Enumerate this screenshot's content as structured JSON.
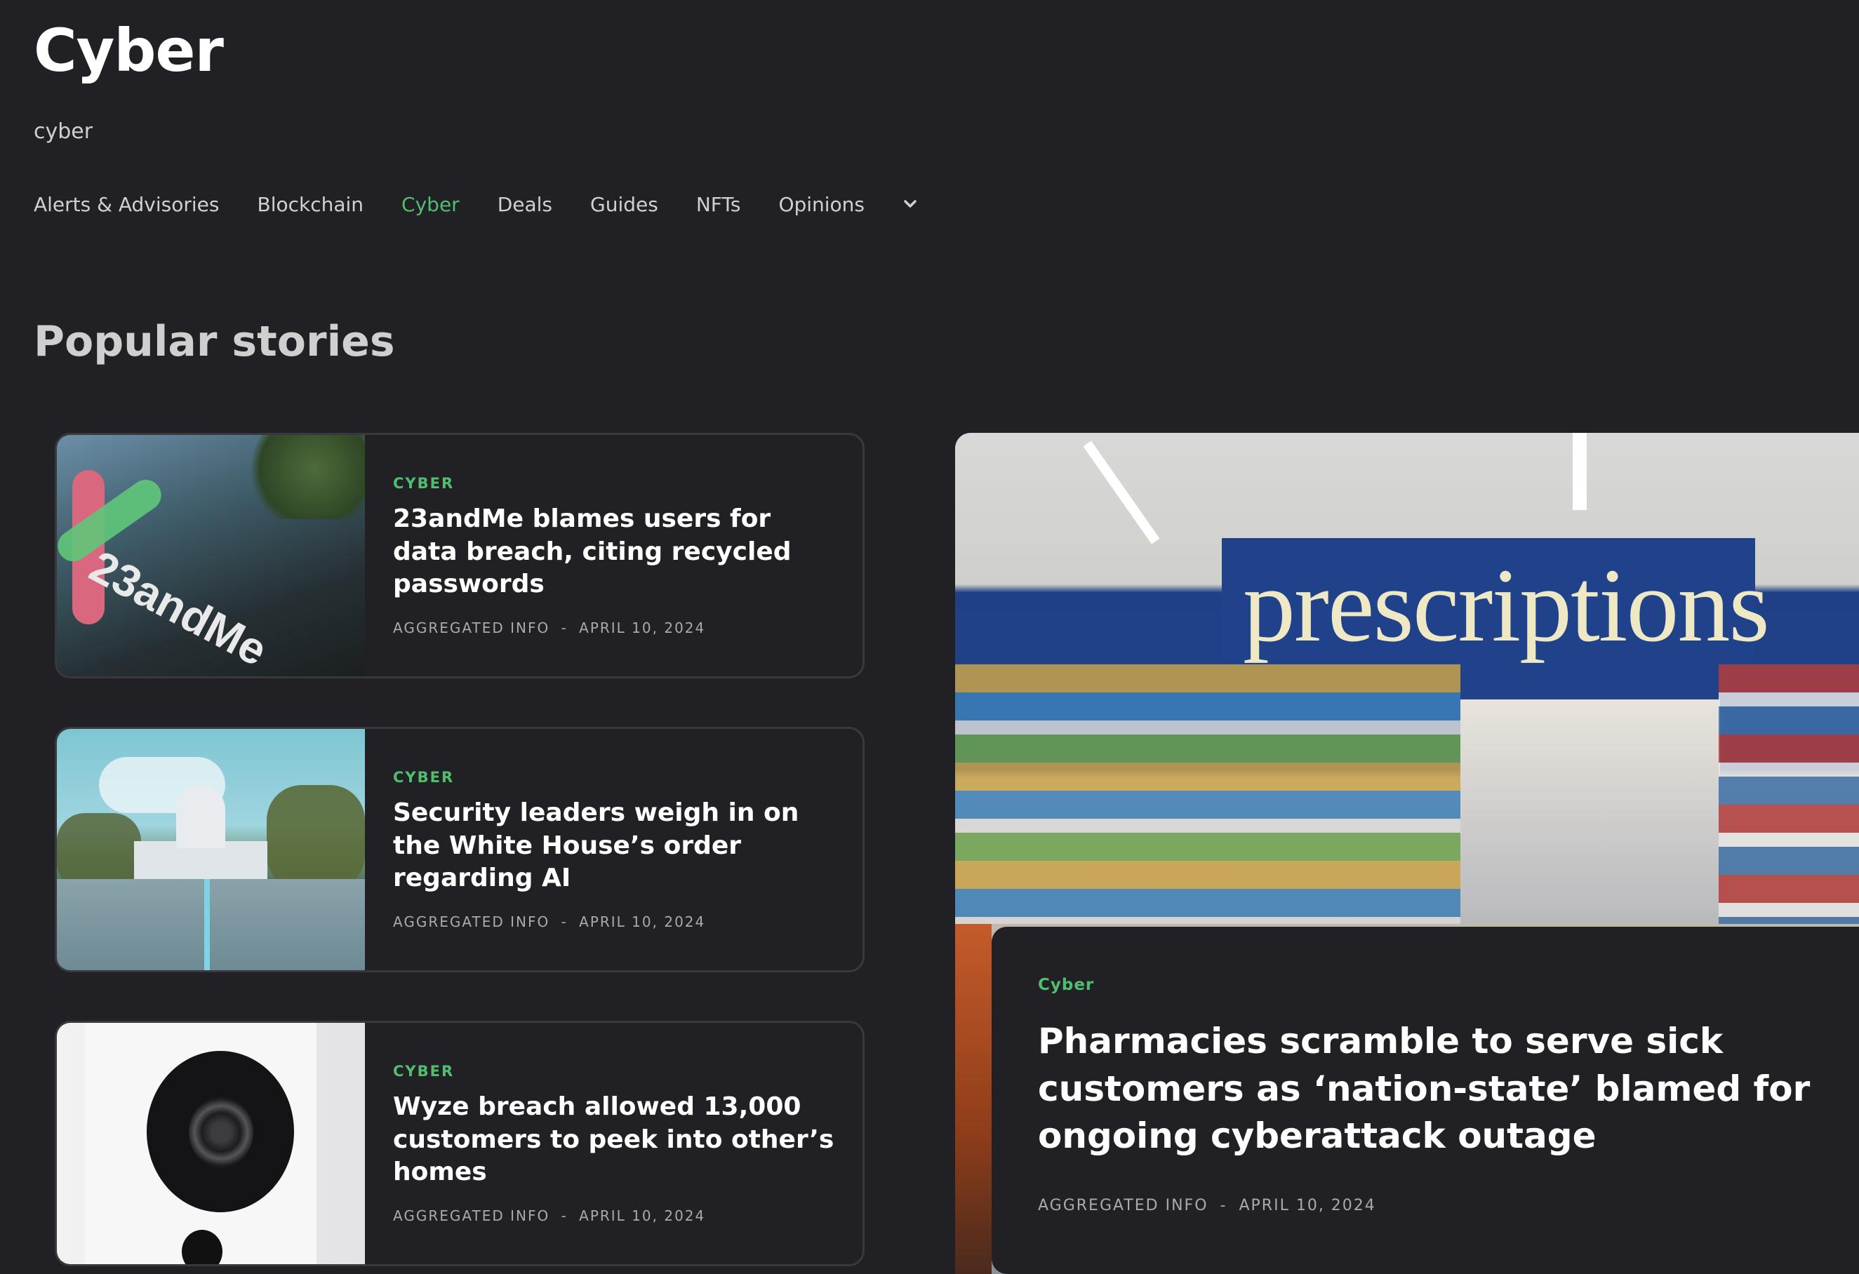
{
  "header": {
    "title": "Cyber",
    "subtitle": "cyber"
  },
  "nav": {
    "items": [
      {
        "label": "Alerts & Advisories",
        "active": false
      },
      {
        "label": "Blockchain",
        "active": false
      },
      {
        "label": "Cyber",
        "active": true
      },
      {
        "label": "Deals",
        "active": false
      },
      {
        "label": "Guides",
        "active": false
      },
      {
        "label": "NFTs",
        "active": false
      },
      {
        "label": "Opinions",
        "active": false
      }
    ],
    "more_icon": "chevron-down-icon"
  },
  "section": {
    "title": "Popular stories"
  },
  "stories": [
    {
      "category": "CYBER",
      "title": "23andMe blames users for data breach, citing recycled passwords",
      "source": "AGGREGATED INFO",
      "separator": "-",
      "date": "APRIL 10, 2024",
      "image": "23andMe building signage"
    },
    {
      "category": "CYBER",
      "title": "Security leaders weigh in on the White House’s order regarding AI",
      "source": "AGGREGATED INFO",
      "separator": "-",
      "date": "APRIL 10, 2024",
      "image": "US Capitol street view"
    },
    {
      "category": "CYBER",
      "title": "Wyze breach allowed 13,000 customers to peek into other’s homes",
      "source": "AGGREGATED INFO",
      "separator": "-",
      "date": "APRIL 10, 2024",
      "image": "Wyze security camera"
    }
  ],
  "featured": {
    "category": "Cyber",
    "title": "Pharmacies scramble to serve sick customers as ‘nation-state’ blamed for ongoing cyberattack outage",
    "source": "AGGREGATED INFO",
    "separator": "-",
    "date": "APRIL 10, 2024",
    "image": "Pharmacy prescriptions counter",
    "image_sign_text": "prescriptions"
  },
  "colors": {
    "background": "#212125",
    "accent": "#4fbf6f",
    "card_border": "#38383d",
    "meta_text": "#a9a9ae",
    "heading_muted": "#cfcfcf"
  }
}
